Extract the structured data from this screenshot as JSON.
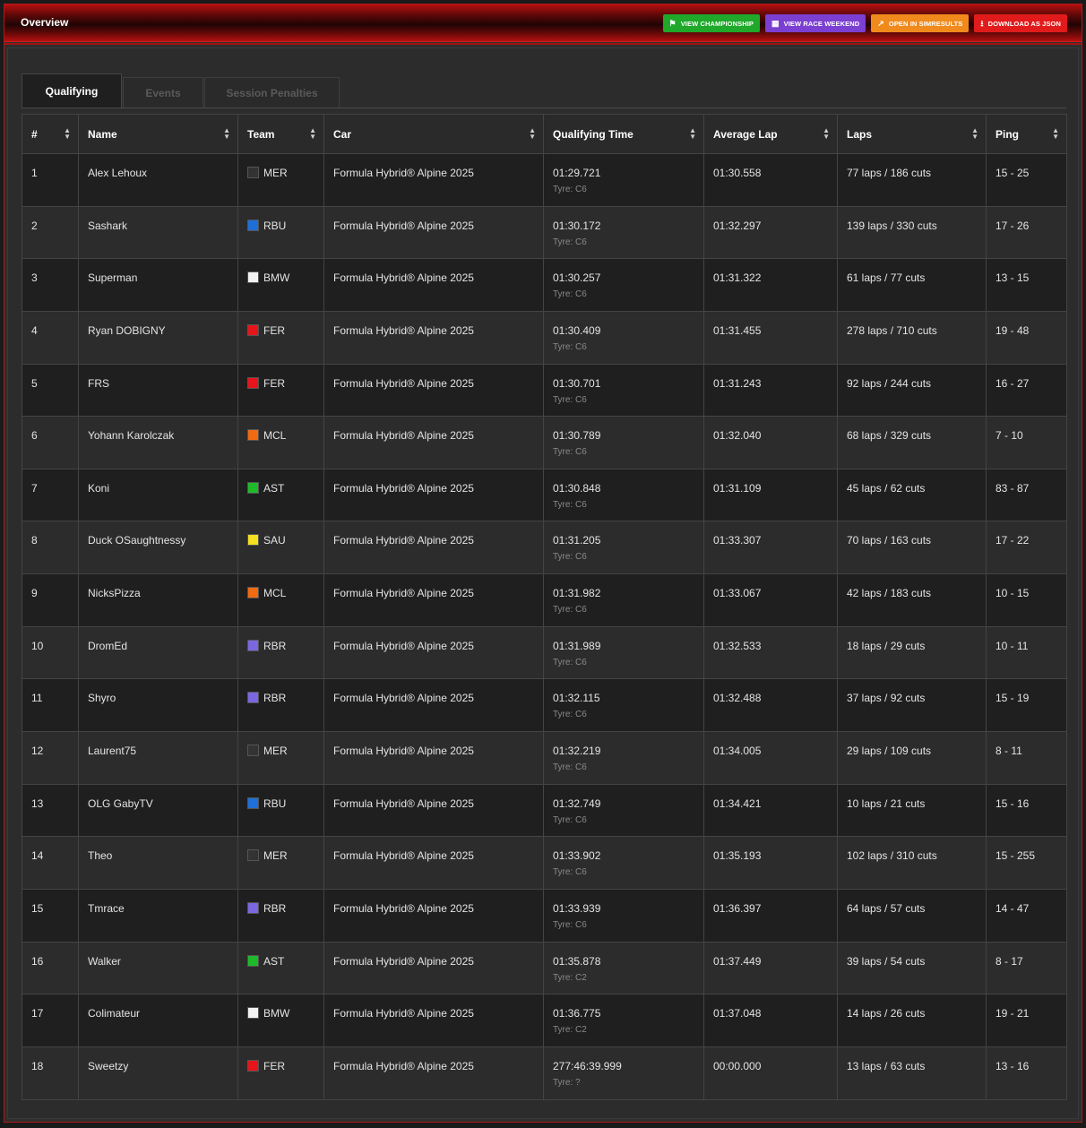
{
  "header": {
    "title": "Overview",
    "buttons": [
      {
        "label": "View Championship",
        "icon": "flag-icon",
        "color": "#1fa82a"
      },
      {
        "label": "View Race Weekend",
        "icon": "calendar-icon",
        "color": "#7b3fd1"
      },
      {
        "label": "Open in SimResults",
        "icon": "external-link-icon",
        "color": "#f08a1c"
      },
      {
        "label": "Download as JSON",
        "icon": "download-icon",
        "color": "#e11b1b"
      }
    ]
  },
  "tabs": [
    {
      "label": "Qualifying",
      "active": true
    },
    {
      "label": "Events",
      "active": false
    },
    {
      "label": "Session Penalties",
      "active": false
    }
  ],
  "columns": [
    "#",
    "Name",
    "Team",
    "Car",
    "Qualifying Time",
    "Average Lap",
    "Laps",
    "Ping"
  ],
  "team_colors": {
    "MER": "#333333",
    "RBU": "#1e6fd9",
    "BMW": "#f2f2f2",
    "FER": "#e8141b",
    "MCL": "#f26a12",
    "AST": "#1fba2a",
    "SAU": "#f5e020",
    "RBR": "#7b68e0"
  },
  "rows": [
    {
      "pos": "1",
      "name": "Alex Lehoux",
      "team": "MER",
      "car": "Formula Hybrid® Alpine 2025",
      "qtime": "01:29.721",
      "tyre": "Tyre: C6",
      "avg": "01:30.558",
      "laps": "77 laps / 186 cuts",
      "ping": "15 - 25"
    },
    {
      "pos": "2",
      "name": "Sashark",
      "team": "RBU",
      "car": "Formula Hybrid® Alpine 2025",
      "qtime": "01:30.172",
      "tyre": "Tyre: C6",
      "avg": "01:32.297",
      "laps": "139 laps / 330 cuts",
      "ping": "17 - 26"
    },
    {
      "pos": "3",
      "name": "Superman",
      "team": "BMW",
      "car": "Formula Hybrid® Alpine 2025",
      "qtime": "01:30.257",
      "tyre": "Tyre: C6",
      "avg": "01:31.322",
      "laps": "61 laps / 77 cuts",
      "ping": "13 - 15"
    },
    {
      "pos": "4",
      "name": "Ryan DOBIGNY",
      "team": "FER",
      "car": "Formula Hybrid® Alpine 2025",
      "qtime": "01:30.409",
      "tyre": "Tyre: C6",
      "avg": "01:31.455",
      "laps": "278 laps / 710 cuts",
      "ping": "19 - 48"
    },
    {
      "pos": "5",
      "name": "FRS",
      "team": "FER",
      "car": "Formula Hybrid® Alpine 2025",
      "qtime": "01:30.701",
      "tyre": "Tyre: C6",
      "avg": "01:31.243",
      "laps": "92 laps / 244 cuts",
      "ping": "16 - 27"
    },
    {
      "pos": "6",
      "name": "Yohann Karolczak",
      "team": "MCL",
      "car": "Formula Hybrid® Alpine 2025",
      "qtime": "01:30.789",
      "tyre": "Tyre: C6",
      "avg": "01:32.040",
      "laps": "68 laps / 329 cuts",
      "ping": "7 - 10"
    },
    {
      "pos": "7",
      "name": "Koni",
      "team": "AST",
      "car": "Formula Hybrid® Alpine 2025",
      "qtime": "01:30.848",
      "tyre": "Tyre: C6",
      "avg": "01:31.109",
      "laps": "45 laps / 62 cuts",
      "ping": "83 - 87"
    },
    {
      "pos": "8",
      "name": "Duck OSaughtnessy",
      "team": "SAU",
      "car": "Formula Hybrid® Alpine 2025",
      "qtime": "01:31.205",
      "tyre": "Tyre: C6",
      "avg": "01:33.307",
      "laps": "70 laps / 163 cuts",
      "ping": "17 - 22"
    },
    {
      "pos": "9",
      "name": "NicksPizza",
      "team": "MCL",
      "car": "Formula Hybrid® Alpine 2025",
      "qtime": "01:31.982",
      "tyre": "Tyre: C6",
      "avg": "01:33.067",
      "laps": "42 laps / 183 cuts",
      "ping": "10 - 15"
    },
    {
      "pos": "10",
      "name": "DromEd",
      "team": "RBR",
      "car": "Formula Hybrid® Alpine 2025",
      "qtime": "01:31.989",
      "tyre": "Tyre: C6",
      "avg": "01:32.533",
      "laps": "18 laps / 29 cuts",
      "ping": "10 - 11"
    },
    {
      "pos": "11",
      "name": "Shyro",
      "team": "RBR",
      "car": "Formula Hybrid® Alpine 2025",
      "qtime": "01:32.115",
      "tyre": "Tyre: C6",
      "avg": "01:32.488",
      "laps": "37 laps / 92 cuts",
      "ping": "15 - 19"
    },
    {
      "pos": "12",
      "name": "Laurent75",
      "team": "MER",
      "car": "Formula Hybrid® Alpine 2025",
      "qtime": "01:32.219",
      "tyre": "Tyre: C6",
      "avg": "01:34.005",
      "laps": "29 laps / 109 cuts",
      "ping": "8 - 11"
    },
    {
      "pos": "13",
      "name": "OLG GabyTV",
      "team": "RBU",
      "car": "Formula Hybrid® Alpine 2025",
      "qtime": "01:32.749",
      "tyre": "Tyre: C6",
      "avg": "01:34.421",
      "laps": "10 laps / 21 cuts",
      "ping": "15 - 16"
    },
    {
      "pos": "14",
      "name": "Theo",
      "team": "MER",
      "car": "Formula Hybrid® Alpine 2025",
      "qtime": "01:33.902",
      "tyre": "Tyre: C6",
      "avg": "01:35.193",
      "laps": "102 laps / 310 cuts",
      "ping": "15 - 255"
    },
    {
      "pos": "15",
      "name": "Tmrace",
      "team": "RBR",
      "car": "Formula Hybrid® Alpine 2025",
      "qtime": "01:33.939",
      "tyre": "Tyre: C6",
      "avg": "01:36.397",
      "laps": "64 laps / 57 cuts",
      "ping": "14 - 47"
    },
    {
      "pos": "16",
      "name": "Walker",
      "team": "AST",
      "car": "Formula Hybrid® Alpine 2025",
      "qtime": "01:35.878",
      "tyre": "Tyre: C2",
      "avg": "01:37.449",
      "laps": "39 laps / 54 cuts",
      "ping": "8 - 17"
    },
    {
      "pos": "17",
      "name": "Colimateur",
      "team": "BMW",
      "car": "Formula Hybrid® Alpine 2025",
      "qtime": "01:36.775",
      "tyre": "Tyre: C2",
      "avg": "01:37.048",
      "laps": "14 laps / 26 cuts",
      "ping": "19 - 21"
    },
    {
      "pos": "18",
      "name": "Sweetzy",
      "team": "FER",
      "car": "Formula Hybrid® Alpine 2025",
      "qtime": "277:46:39.999",
      "tyre": "Tyre: ?",
      "avg": "00:00.000",
      "laps": "13 laps / 63 cuts",
      "ping": "13 - 16"
    }
  ]
}
